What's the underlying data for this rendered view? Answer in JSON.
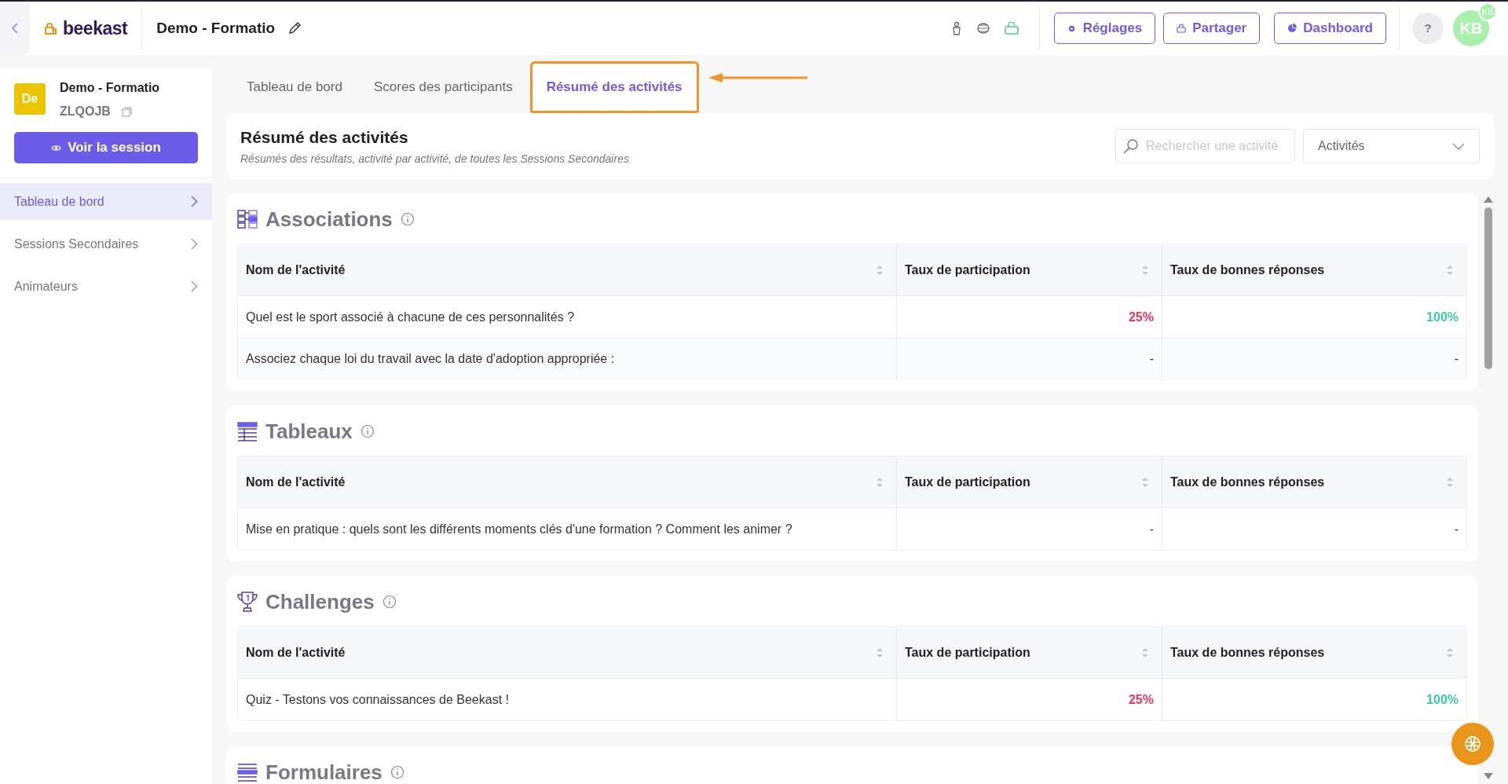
{
  "topbar": {
    "logo": "beekast",
    "session_title": "Demo - Formatio",
    "buttons": [
      {
        "kind": "gear",
        "label": "Réglages"
      },
      {
        "kind": "share",
        "label": "Partager"
      },
      {
        "kind": "pie",
        "label": "Dashboard"
      }
    ],
    "help": "?",
    "avatar": "KB",
    "avatar_badge": "KB"
  },
  "sidebar": {
    "badge": "De",
    "session_name": "Demo - Formatio",
    "code": "ZLQOJB",
    "view_button": "Voir la session",
    "items": [
      {
        "label": "Tableau de bord",
        "selected": true
      },
      {
        "label": "Sessions Secondaires",
        "selected": false
      },
      {
        "label": "Animateurs",
        "selected": false
      }
    ]
  },
  "tabs": [
    {
      "label": "Tableau de bord",
      "selected": false,
      "highlighted": false
    },
    {
      "label": "Scores des participants",
      "selected": false,
      "highlighted": false
    },
    {
      "label": "Résumé des activités",
      "selected": true,
      "highlighted": true
    }
  ],
  "header": {
    "title": "Résumé des activités",
    "subtitle": "Résumés des résultats, activité par activité, de toutes les Sessions Secondaires",
    "search": {
      "placeholder": "Rechercher une activité"
    },
    "filter": {
      "value": "Activités"
    }
  },
  "sections": [
    {
      "kind": "associations",
      "title": "Associations",
      "columns": [
        "Nom de l'activité",
        "Taux de participation",
        "Taux de bonnes réponses"
      ],
      "rows": [
        {
          "name": "Quel est le sport associé à chacune de ces personnalités ?",
          "participation": {
            "text": "25%",
            "color": "#e8335a"
          },
          "correct": {
            "text": "100%",
            "color": "#3ec9a4"
          }
        },
        {
          "name": "Associez chaque loi du travail avec la date d'adoption appropriée :",
          "participation": {
            "text": "-"
          },
          "correct": {
            "text": "-"
          }
        }
      ]
    },
    {
      "kind": "tables",
      "title": "Tableaux",
      "columns": [
        "Nom de l'activité",
        "Taux de participation",
        "Taux de bonnes réponses"
      ],
      "rows": [
        {
          "name": "Mise en pratique : quels sont les différents moments clés d'une formation ? Comment les animer ?",
          "participation": {
            "text": "-"
          },
          "correct": {
            "text": "-"
          }
        }
      ]
    },
    {
      "kind": "challenges",
      "title": "Challenges",
      "columns": [
        "Nom de l'activité",
        "Taux de participation",
        "Taux de bonnes réponses"
      ],
      "rows": [
        {
          "name": "Quiz - Testons vos connaissances de Beekast !",
          "participation": {
            "text": "25%",
            "color": "#e8335a"
          },
          "correct": {
            "text": "100%",
            "color": "#3ec9a4"
          }
        }
      ]
    },
    {
      "kind": "forms",
      "title": "Formulaires"
    }
  ]
}
